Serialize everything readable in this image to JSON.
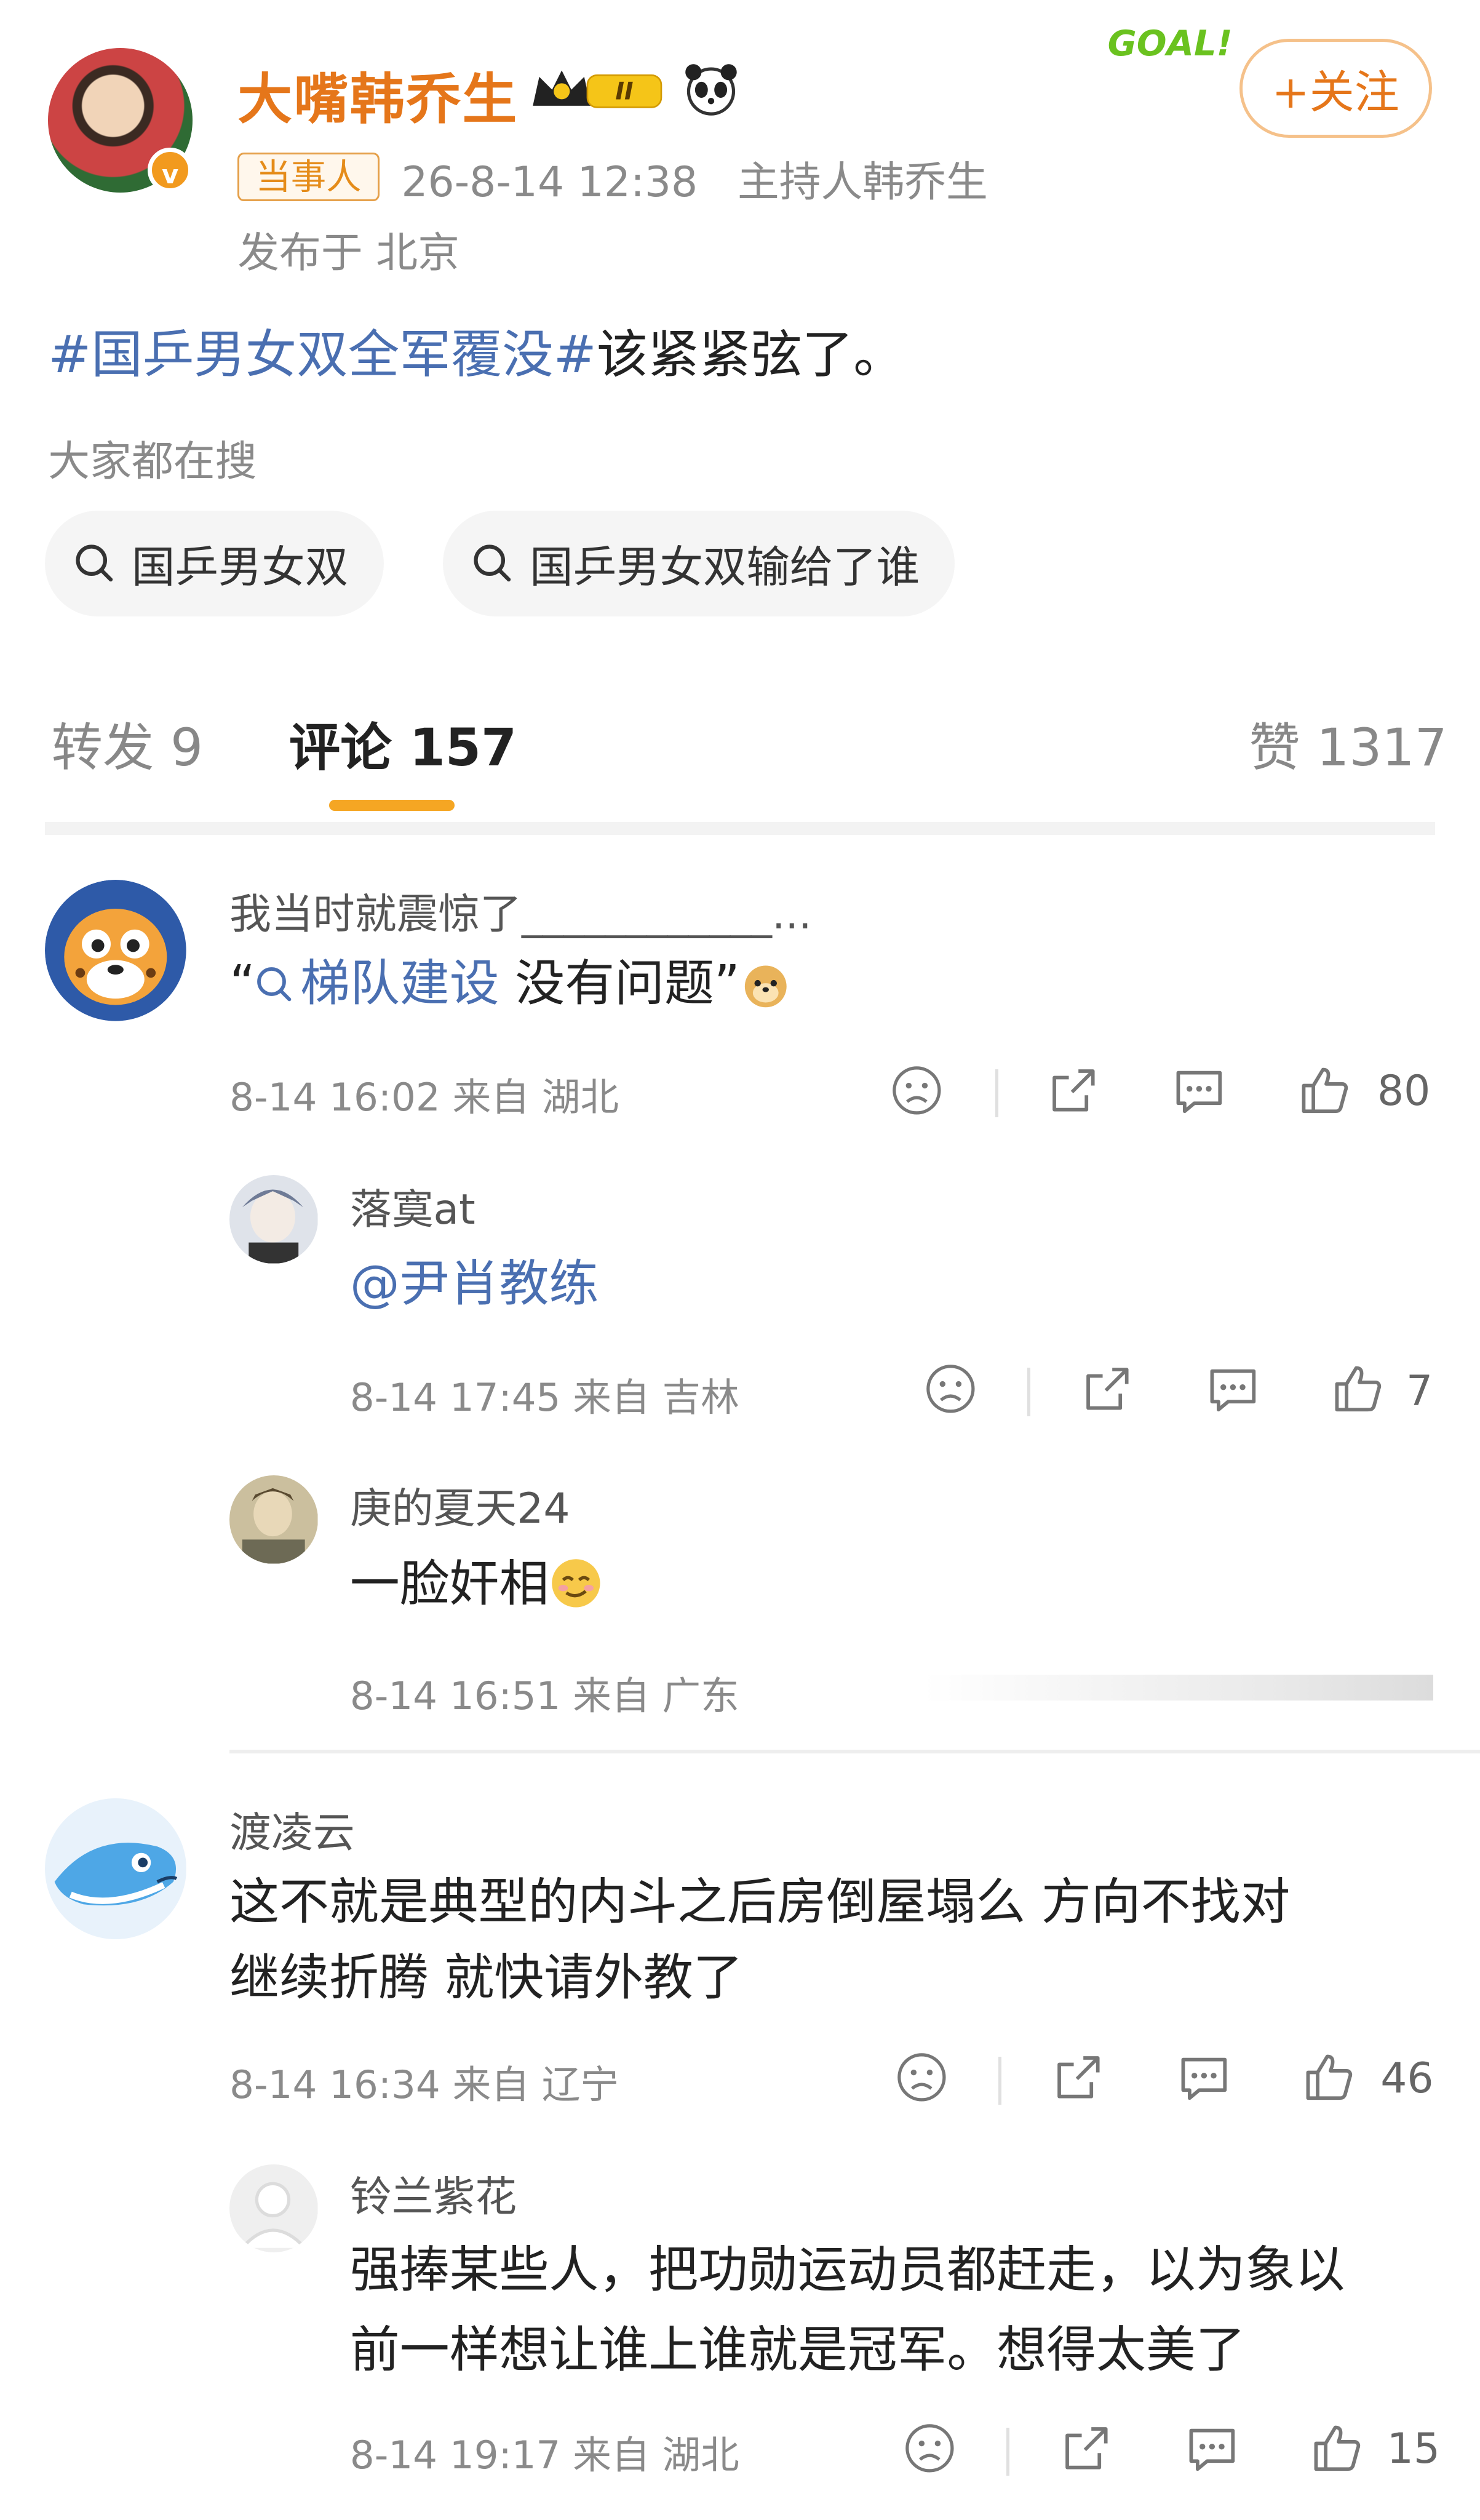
{
  "post": {
    "username": "大嘴韩乔生",
    "level_badge": "II",
    "tag": "当事人",
    "timestamp": "26-8-14 12:38",
    "host_label": "主持人韩乔生",
    "location": "发布于 北京",
    "topic": "#国乒男女双全军覆没#",
    "text": "该紧紧弦了。",
    "goal_sticker": "GOAL!",
    "follow_label": "+关注",
    "search_hint": "大家都在搜",
    "search_chips": [
      "国乒男女双",
      "国乒男女双输给了谁"
    ]
  },
  "tabs": {
    "repost": "转发 9",
    "comments": "评论 157",
    "likes": "赞 1317"
  },
  "comments": [
    {
      "name": "我当时就震惊了____________...",
      "quote_open": "“",
      "search_link": "梯队建设",
      "text_after": " 没有问题”",
      "meta": "8-14 16:02  来自 湖北",
      "likes": "80",
      "replies": [
        {
          "name": "落寞at",
          "text": "@尹肖教练",
          "meta": "8-14 17:45  来自 吉林",
          "likes": "7"
        },
        {
          "name": "庚的夏天24",
          "text": "一脸奸相",
          "meta": "8-14 16:51  来自 广东",
          "likes": ""
        }
      ]
    },
    {
      "name": "渡凌云",
      "text_line1": "这不就是典型的内斗之后房倒屋塌么  方向不找对",
      "text_line2": "继续折腾  就快请外教了",
      "meta": "8-14 16:34  来自 辽宁",
      "likes": "46",
      "replies": [
        {
          "name": "铃兰紫花",
          "text_line1": "强捧某些人，把功勋运动员都赶走，以为象以",
          "text_line2": "前一样想让谁上谁就是冠军。想得太美了",
          "meta": "8-14 19:17  来自 湖北",
          "likes": "15"
        }
      ]
    }
  ],
  "colors": {
    "accent": "#e5761a",
    "link": "#4a6fb1",
    "tab_underline": "#f5a623"
  }
}
